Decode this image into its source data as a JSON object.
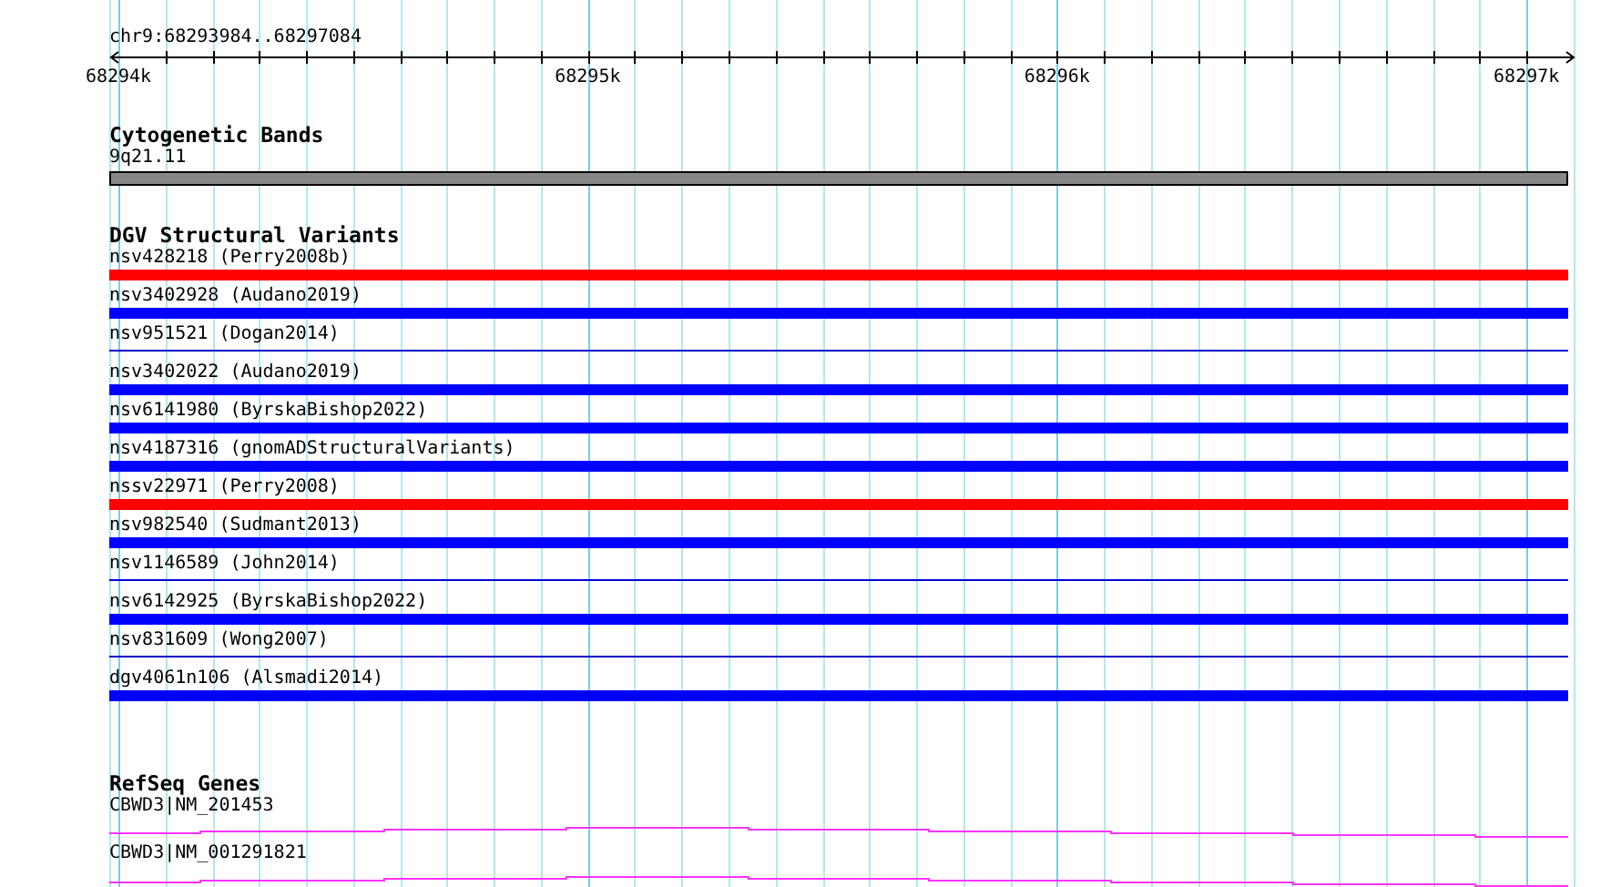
{
  "ruler": {
    "position": "chr9:68293984..68297084",
    "tick_labels": [
      "68294k",
      "68295k",
      "68296k",
      "68297k"
    ]
  },
  "tracks": [
    {
      "kind": "bands",
      "title": "Cytogenetic Bands",
      "items": [
        {
          "label": "9q21.11",
          "color": "#888888"
        }
      ]
    },
    {
      "kind": "variants",
      "title": "DGV Structural Variants",
      "items": [
        {
          "label": "nsv428218 (Perry2008b)",
          "kind": "bar",
          "color": "#ff0000"
        },
        {
          "label": "nsv3402928 (Audano2019)",
          "kind": "bar",
          "color": "#0000ff"
        },
        {
          "label": "nsv951521 (Dogan2014)",
          "kind": "line",
          "color": "#0000cc"
        },
        {
          "label": "nsv3402022 (Audano2019)",
          "kind": "bar",
          "color": "#0000ff"
        },
        {
          "label": "nsv6141980 (ByrskaBishop2022)",
          "kind": "bar",
          "color": "#0000ff"
        },
        {
          "label": "nsv4187316 (gnomADStructuralVariants)",
          "kind": "bar",
          "color": "#0000ff"
        },
        {
          "label": "nssv22971 (Perry2008)",
          "kind": "bar",
          "color": "#ff0000"
        },
        {
          "label": "nsv982540 (Sudmant2013)",
          "kind": "bar",
          "color": "#0000ff"
        },
        {
          "label": "nsv1146589 (John2014)",
          "kind": "line",
          "color": "#0000cc"
        },
        {
          "label": "nsv6142925 (ByrskaBishop2022)",
          "kind": "bar",
          "color": "#0000ff"
        },
        {
          "label": "nsv831609 (Wong2007)",
          "kind": "line",
          "color": "#0000cc"
        },
        {
          "label": "dgv4061n106 (Alsmadi2014)",
          "kind": "bar",
          "color": "#0000ff"
        }
      ]
    },
    {
      "kind": "genes",
      "title": "RefSeq Genes",
      "items": [
        {
          "label": "CBWD3|NM_201453"
        },
        {
          "label": "CBWD3|NM_001291821"
        }
      ]
    }
  ]
}
